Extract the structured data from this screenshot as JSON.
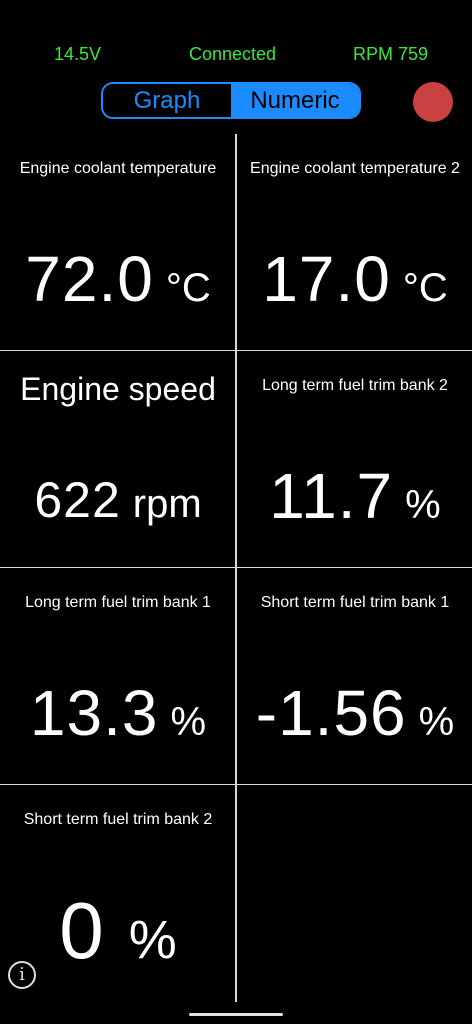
{
  "status": {
    "voltage": "14.5V",
    "connection": "Connected",
    "rpm": "RPM 759",
    "color": "#39e83a"
  },
  "view_toggle": {
    "graph_label": "Graph",
    "numeric_label": "Numeric",
    "selected": "Numeric",
    "accent": "#1a8cff"
  },
  "record_button": {
    "icon": "record-dot-icon",
    "color": "#c94141"
  },
  "gauges": [
    {
      "label": "Engine coolant temperature",
      "value": "72.0",
      "unit": "°C"
    },
    {
      "label": "Engine coolant temperature 2",
      "value": "17.0",
      "unit": "°C"
    },
    {
      "label": "Engine speed",
      "value": "622",
      "unit": "rpm"
    },
    {
      "label": "Long term fuel trim bank 2",
      "value": "11.7",
      "unit": "%"
    },
    {
      "label": "Long term fuel trim bank 1",
      "value": "13.3",
      "unit": "%"
    },
    {
      "label": "Short term fuel trim bank 1",
      "value": "-1.56",
      "unit": "%"
    },
    {
      "label": "Short term fuel trim bank 2",
      "value": "0",
      "unit": "%"
    }
  ],
  "info_button": {
    "glyph": "i",
    "icon": "info-icon"
  }
}
